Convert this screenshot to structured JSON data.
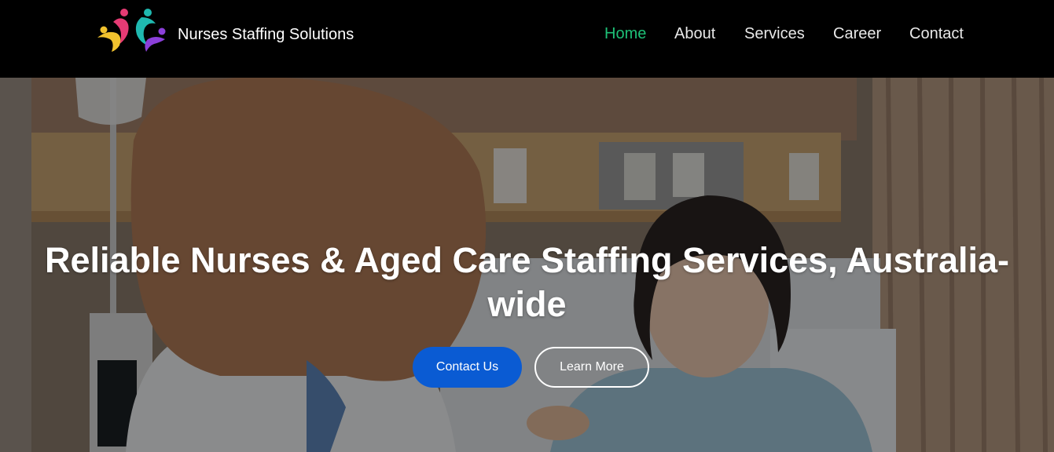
{
  "header": {
    "brand": "Nurses Staffing Solutions",
    "logo_icon": "three-people-logo-icon",
    "nav": [
      {
        "label": "Home",
        "active": true
      },
      {
        "label": "About",
        "active": false
      },
      {
        "label": "Services",
        "active": false
      },
      {
        "label": "Career",
        "active": false
      },
      {
        "label": "Contact",
        "active": false
      }
    ]
  },
  "hero": {
    "title_line1": "Reliable Nurses & Aged Care Staffing Services, Australia-",
    "title_line2": "wide",
    "primary_button": "Contact Us",
    "secondary_button": "Learn More",
    "background_image": "nurse-with-patient-photo"
  },
  "colors": {
    "header_bg": "#000000",
    "nav_active": "#1ec077",
    "nav_text": "#e9e9e9",
    "primary_button": "#0a5bd3"
  }
}
